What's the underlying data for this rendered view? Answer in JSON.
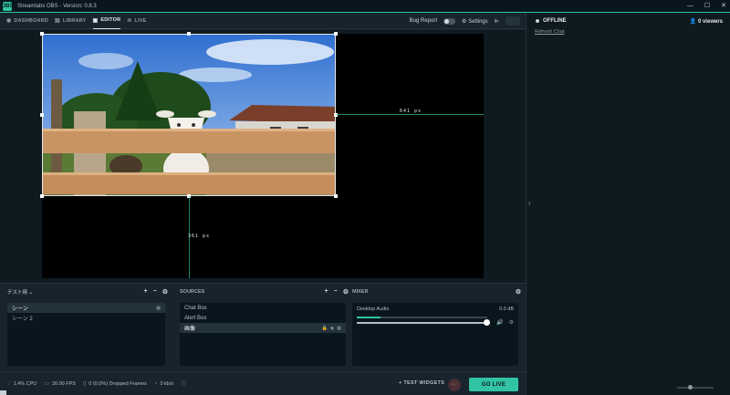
{
  "window": {
    "logo_text": "OBS",
    "title": "Streamlabs OBS - Version: 0.8.3",
    "minimize": "—",
    "maximize": "☐",
    "close": "✕"
  },
  "nav": {
    "tabs": [
      {
        "label": "DASHBOARD",
        "icon": "dashboard-icon"
      },
      {
        "label": "LIBRARY",
        "icon": "library-icon"
      },
      {
        "label": "EDITOR",
        "icon": "editor-icon",
        "active": true
      },
      {
        "label": "LIVE",
        "icon": "live-icon"
      }
    ],
    "bug_report": "Bug Report",
    "settings": "Settings"
  },
  "editor": {
    "width_label": "641 px",
    "height_label": "361 px"
  },
  "scenes": {
    "collection": "テスト用",
    "items": [
      {
        "label": "シーン",
        "selected": true
      },
      {
        "label": "シーン 2",
        "selected": false
      }
    ]
  },
  "sources": {
    "title": "SOURCES",
    "items": [
      {
        "label": "Chat Box",
        "selected": false
      },
      {
        "label": "Alert Box",
        "selected": false
      },
      {
        "label": "画像",
        "selected": true
      }
    ]
  },
  "mixer": {
    "title": "MIXER",
    "items": [
      {
        "label": "Desktop Audio",
        "level_db": "0.0 dB",
        "meter_fraction": 0.18,
        "volume_fraction": 1.0
      }
    ]
  },
  "footer": {
    "cpu": "1.4% CPU",
    "fps": "30.00 FPS",
    "dropped": "0 (0.0%) Dropped Frames",
    "bandwidth": "0 kb/s",
    "test_widgets": "+ TEST WIDGETS",
    "rec": "REC",
    "go_live": "GO LIVE"
  },
  "chat": {
    "status": "OFFLINE",
    "viewers": "0 viewers",
    "refresh": "Refresh Chat"
  },
  "colors": {
    "accent": "#31c3a2",
    "background": "#17242d",
    "panel": "#09161d"
  }
}
